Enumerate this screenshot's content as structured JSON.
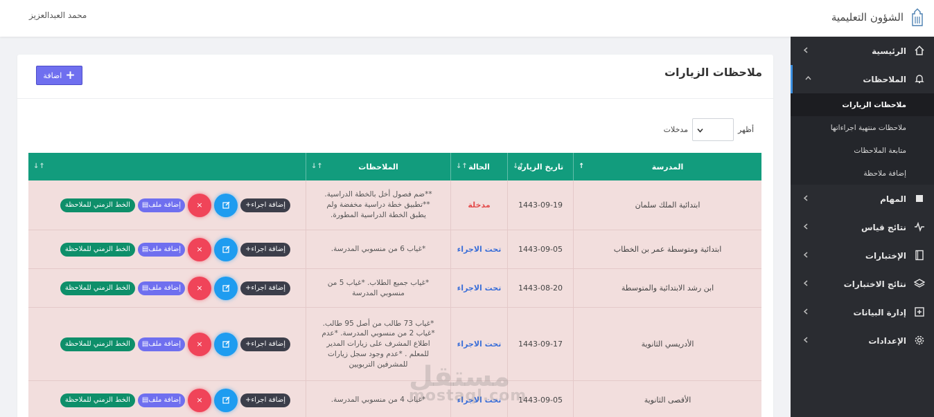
{
  "topbar": {
    "user_name": "محمد العبدالعزيز",
    "brand_name": "الشؤون التعليمية",
    "logo_icon": "building-logo-icon"
  },
  "sidebar": {
    "items": [
      {
        "label": "الرئيسية",
        "icon": "home-icon"
      },
      {
        "label": "الملاحظات",
        "icon": "bell-icon",
        "expanded": true
      },
      {
        "label": "المهام",
        "icon": "square-icon"
      },
      {
        "label": "نتائج قياس",
        "icon": "pulse-icon"
      },
      {
        "label": "الإختبارات",
        "icon": "book-icon"
      },
      {
        "label": "نتائج الاختبارات",
        "icon": "layers-icon"
      },
      {
        "label": "إدارة البيانات",
        "icon": "plus-square-icon"
      },
      {
        "label": "الإعدادات",
        "icon": "gear-icon"
      }
    ],
    "sub_items": [
      {
        "label": "ملاحظات الزيارات",
        "current": true
      },
      {
        "label": "ملاحظات منتهية اجراءاتها"
      },
      {
        "label": "متابعة الملاحظات"
      },
      {
        "label": "إضافة ملاحظة"
      }
    ]
  },
  "card": {
    "title": "ملاحظات الزيارات",
    "add_label": "اضافة",
    "show_label": "أظهر",
    "entries_label": "مدخلات"
  },
  "table": {
    "headers": [
      "المدرسة",
      "تاريخ الزيارة",
      "الحالة",
      "الملاحظات",
      ""
    ],
    "rows": [
      {
        "school": "ابتدائية الملك سلمان",
        "date": "1443-09-19",
        "status": "مدخلة",
        "status_kind": "red",
        "notes": "**ضم فصول أخل بالخطة الدراسية. **تطبيق خطة دراسية مخفضة ولم يطبق الخطة الدراسية المطورة."
      },
      {
        "school": "ابتدائية ومتوسطة عمر بن الخطاب",
        "date": "1443-09-05",
        "status": "تحت الاجراء",
        "status_kind": "blue",
        "notes": "*غياب 6 من منسوبي المدرسة."
      },
      {
        "school": "ابن رشد الابتدائية والمتوسطة",
        "date": "1443-08-20",
        "status": "تحت الاجراء",
        "status_kind": "blue",
        "notes": "*غياب جميع الطلاب. *غياب 5 من منسوبي المدرسة"
      },
      {
        "school": "الأدريسي الثانوية",
        "date": "1443-09-17",
        "status": "تحت الاجراء",
        "status_kind": "blue",
        "notes": "*غياب 73 طالب من أصل 95 طالب. *غياب 2 من منسوبي المدرسة. *عدم اطلاع المشرف على زيارات المدير للمعلم . *عدم وجود سجل زيارات للمشرفين التربويين"
      },
      {
        "school": "الأقصى الثانوية",
        "date": "1443-09-05",
        "status": "تحت الاجراء",
        "status_kind": "blue",
        "notes": "*غياب 4 من منسوبي المدرسة."
      }
    ],
    "actions": {
      "add_action": "إضافة اجراء+",
      "edit_icon": "edit-icon",
      "delete_icon": "close-icon",
      "delete_symbol": "×",
      "add_file": "إضافة ملف",
      "timeline": "الخط الزمني للملاحظة"
    }
  },
  "watermark": {
    "line1": "مستقل",
    "line2": "mostaql.com"
  },
  "colors": {
    "accent": "#6f6fef",
    "table_header": "#129c7d",
    "row_bg": "#f2dedd",
    "sidebar_bg": "#2a2c31"
  }
}
